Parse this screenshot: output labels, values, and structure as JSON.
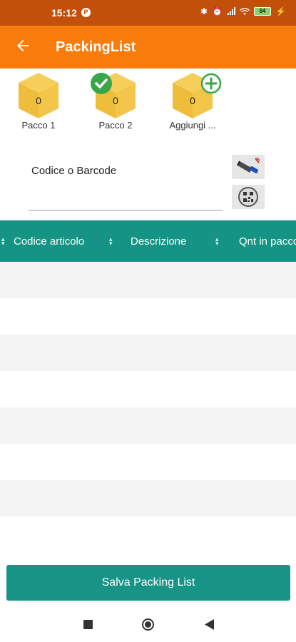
{
  "status_bar": {
    "time": "15:12",
    "notification_icon": "p-circle-icon",
    "battery_level": "84",
    "icons": [
      "bluetooth-icon",
      "alarm-icon",
      "signal-icon",
      "wifi-icon",
      "battery-icon",
      "charging-icon"
    ]
  },
  "app_bar": {
    "title": "PackingList",
    "back_icon": "arrow-left-icon",
    "color": "#f77c0c"
  },
  "packages": [
    {
      "label": "Pacco 1",
      "count": "0",
      "badge": ""
    },
    {
      "label": "Pacco 2",
      "count": "0",
      "badge": "check-circle-icon"
    },
    {
      "label": "Aggiungi ...",
      "count": "0",
      "badge": "plus-circle-icon"
    }
  ],
  "code_input": {
    "placeholder": "Codice o Barcode",
    "value": ""
  },
  "tools": {
    "scanner_icon": "barcode-scanner-icon",
    "qr_icon": "qr-code-icon"
  },
  "table": {
    "columns": [
      "Codice articolo",
      "Descrizione",
      "Qnt in pacco"
    ],
    "header_color": "#159485",
    "rows": []
  },
  "actions": {
    "save_label": "Salva Packing List"
  },
  "nav": {
    "recents_icon": "square-icon",
    "home_icon": "circle-icon",
    "back_icon": "triangle-left-icon"
  }
}
